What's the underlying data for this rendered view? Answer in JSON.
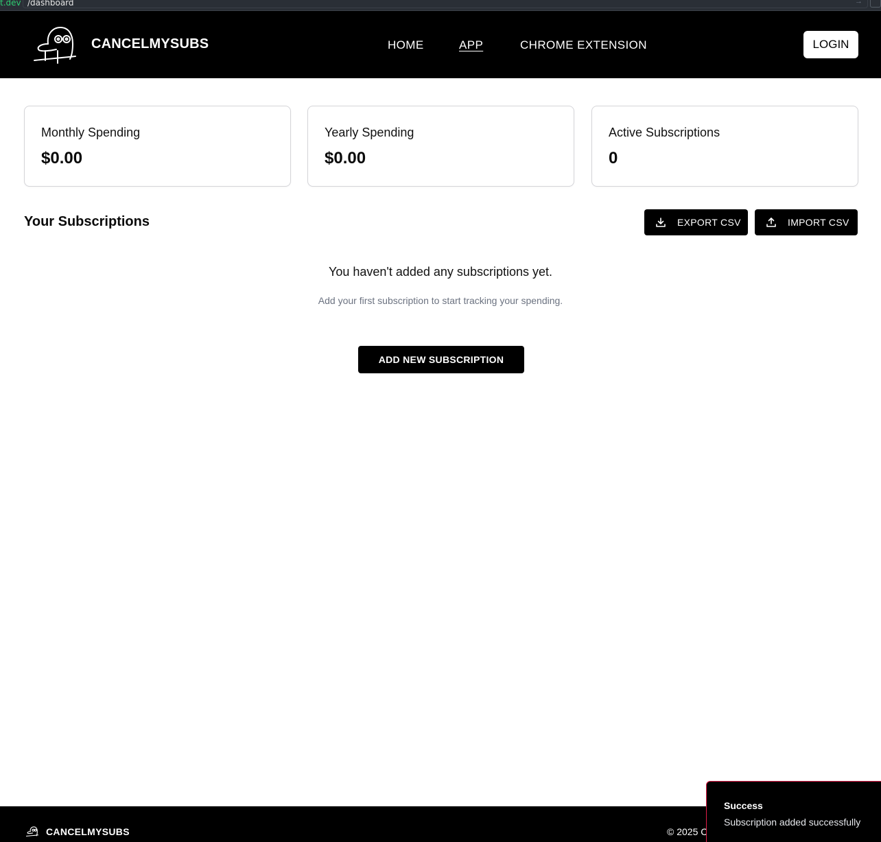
{
  "browser": {
    "domain_fragment": "t.dev",
    "path": "/dashboard"
  },
  "header": {
    "brand": "CANCELMYSUBS",
    "nav": [
      {
        "label": "HOME",
        "active": false
      },
      {
        "label": "APP",
        "active": true
      },
      {
        "label": "CHROME EXTENSION",
        "active": false
      }
    ],
    "login_label": "LOGIN"
  },
  "stats": [
    {
      "label": "Monthly Spending",
      "value": "$0.00"
    },
    {
      "label": "Yearly Spending",
      "value": "$0.00"
    },
    {
      "label": "Active Subscriptions",
      "value": "0"
    }
  ],
  "subscriptions": {
    "title": "Your Subscriptions",
    "export_label": "EXPORT CSV",
    "import_label": "IMPORT CSV",
    "empty_title": "You haven't added any subscriptions yet.",
    "empty_subtitle": "Add your first subscription to start tracking your spending.",
    "add_label": "ADD NEW SUBSCRIPTION"
  },
  "footer": {
    "brand": "CANCELMYSUBS",
    "copyright": "© 2025 C"
  },
  "toast": {
    "title": "Success",
    "message": "Subscription added successfully"
  },
  "colors": {
    "header_bg": "#000000",
    "toast_border": "#e11d48",
    "url_domain": "#2ecc71"
  },
  "icons": {
    "logo": "doodle-face-icon",
    "export": "download-icon",
    "import": "upload-icon"
  }
}
